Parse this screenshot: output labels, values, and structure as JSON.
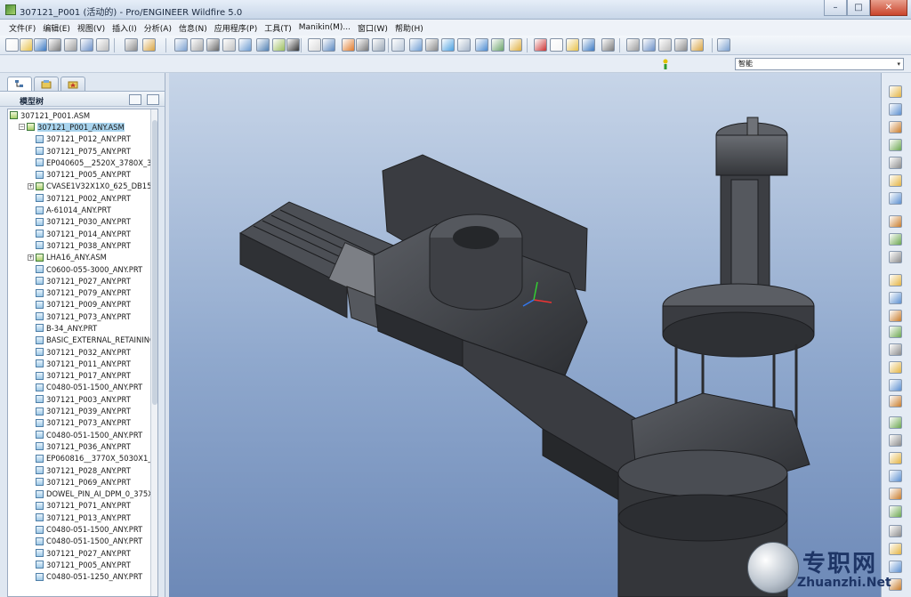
{
  "window": {
    "title": "307121_P001 (活动的) - Pro/ENGINEER Wildfire 5.0",
    "minimize_glyph": "–",
    "maximize_glyph": "□",
    "close_glyph": "✕"
  },
  "menubar": {
    "items": [
      {
        "label": "文件(F)"
      },
      {
        "label": "编辑(E)"
      },
      {
        "label": "视图(V)"
      },
      {
        "label": "插入(I)"
      },
      {
        "label": "分析(A)"
      },
      {
        "label": "信息(N)"
      },
      {
        "label": "应用程序(P)"
      },
      {
        "label": "工具(T)"
      },
      {
        "label": "Manikin(M)..."
      },
      {
        "label": "窗口(W)"
      },
      {
        "label": "帮助(H)"
      }
    ]
  },
  "selection_filter": {
    "value": "智能",
    "arrow": "▾"
  },
  "model_tree": {
    "header_label": "模型树",
    "rows": [
      {
        "label": "307121_P001.ASM",
        "type": "asm",
        "level": 0,
        "expander": ""
      },
      {
        "label": "307121_P001_ANY.ASM",
        "type": "asm",
        "level": 1,
        "expander": "−",
        "selected": true
      },
      {
        "label": "307121_P012_ANY.PRT",
        "type": "prt",
        "level": 2,
        "expander": ""
      },
      {
        "label": "307121_P075_ANY.PRT",
        "type": "prt",
        "level": 2,
        "expander": ""
      },
      {
        "label": "EP040605__2520X_3780X_313_",
        "type": "prt",
        "level": 2,
        "expander": ""
      },
      {
        "label": "307121_P005_ANY.PRT",
        "type": "prt",
        "level": 2,
        "expander": ""
      },
      {
        "label": "CVASE1V32X1X0_625_DB15_L",
        "type": "asm",
        "level": 2,
        "expander": "+"
      },
      {
        "label": "307121_P002_ANY.PRT",
        "type": "prt",
        "level": 2,
        "expander": ""
      },
      {
        "label": "A-61014_ANY.PRT",
        "type": "prt",
        "level": 2,
        "expander": ""
      },
      {
        "label": "307121_P030_ANY.PRT",
        "type": "prt",
        "level": 2,
        "expander": ""
      },
      {
        "label": "307121_P014_ANY.PRT",
        "type": "prt",
        "level": 2,
        "expander": ""
      },
      {
        "label": "307121_P038_ANY.PRT",
        "type": "prt",
        "level": 2,
        "expander": ""
      },
      {
        "label": "LHA16_ANY.ASM",
        "type": "asm",
        "level": 2,
        "expander": "+"
      },
      {
        "label": "C0600-055-3000_ANY.PRT",
        "type": "prt",
        "level": 2,
        "expander": ""
      },
      {
        "label": "307121_P027_ANY.PRT",
        "type": "prt",
        "level": 2,
        "expander": ""
      },
      {
        "label": "307121_P079_ANY.PRT",
        "type": "prt",
        "level": 2,
        "expander": ""
      },
      {
        "label": "307121_P009_ANY.PRT",
        "type": "prt",
        "level": 2,
        "expander": ""
      },
      {
        "label": "307121_P073_ANY.PRT",
        "type": "prt",
        "level": 2,
        "expander": ""
      },
      {
        "label": "B-34_ANY.PRT",
        "type": "prt",
        "level": 2,
        "expander": ""
      },
      {
        "label": "BASIC_EXTERNAL_RETAINING",
        "type": "prt",
        "level": 2,
        "expander": ""
      },
      {
        "label": "307121_P032_ANY.PRT",
        "type": "prt",
        "level": 2,
        "expander": ""
      },
      {
        "label": "307121_P011_ANY.PRT",
        "type": "prt",
        "level": 2,
        "expander": ""
      },
      {
        "label": "307121_P017_ANY.PRT",
        "type": "prt",
        "level": 2,
        "expander": ""
      },
      {
        "label": "C0480-051-1500_ANY.PRT",
        "type": "prt",
        "level": 2,
        "expander": ""
      },
      {
        "label": "307121_P003_ANY.PRT",
        "type": "prt",
        "level": 2,
        "expander": ""
      },
      {
        "label": "307121_P039_ANY.PRT",
        "type": "prt",
        "level": 2,
        "expander": ""
      },
      {
        "label": "307121_P073_ANY.PRT",
        "type": "prt",
        "level": 2,
        "expander": ""
      },
      {
        "label": "C0480-051-1500_ANY.PRT",
        "type": "prt",
        "level": 2,
        "expander": ""
      },
      {
        "label": "307121_P036_ANY.PRT",
        "type": "prt",
        "level": 2,
        "expander": ""
      },
      {
        "label": "EP060816__3770X_5030X1_00_",
        "type": "prt",
        "level": 2,
        "expander": ""
      },
      {
        "label": "307121_P028_ANY.PRT",
        "type": "prt",
        "level": 2,
        "expander": ""
      },
      {
        "label": "307121_P069_ANY.PRT",
        "type": "prt",
        "level": 2,
        "expander": ""
      },
      {
        "label": "DOWEL_PIN_AI_DPM_0_375X1",
        "type": "prt",
        "level": 2,
        "expander": ""
      },
      {
        "label": "307121_P071_ANY.PRT",
        "type": "prt",
        "level": 2,
        "expander": ""
      },
      {
        "label": "307121_P013_ANY.PRT",
        "type": "prt",
        "level": 2,
        "expander": ""
      },
      {
        "label": "C0480-051-1500_ANY.PRT",
        "type": "prt",
        "level": 2,
        "expander": ""
      },
      {
        "label": "C0480-051-1500_ANY.PRT",
        "type": "prt",
        "level": 2,
        "expander": ""
      },
      {
        "label": "307121_P027_ANY.PRT",
        "type": "prt",
        "level": 2,
        "expander": ""
      },
      {
        "label": "307121_P005_ANY.PRT",
        "type": "prt",
        "level": 2,
        "expander": ""
      },
      {
        "label": "C0480-051-1250_ANY.PRT",
        "type": "prt",
        "level": 2,
        "expander": ""
      }
    ]
  },
  "watermark": {
    "brand_cn": "专职网",
    "brand_en": "Zhuanzhi.Net"
  },
  "colors": {
    "viewport_top": "#c7d5e8",
    "viewport_bottom": "#6d89b7",
    "model_gray": "#3d3f44"
  }
}
